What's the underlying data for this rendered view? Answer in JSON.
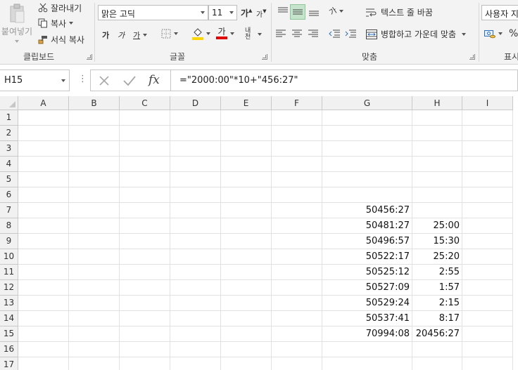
{
  "ribbon": {
    "clipboard": {
      "paste_label": "붙여넣기",
      "cut_label": "잘라내기",
      "copy_label": "복사",
      "format_painter_label": "서식 복사",
      "group_label": "클립보드"
    },
    "font": {
      "font_name": "맑은 고딕",
      "font_size": "11",
      "grow_label": "가",
      "shrink_label": "가",
      "bold_label": "가",
      "italic_label": "가",
      "underline_label": "가",
      "font_color_label": "가",
      "phonetic_label": "내천",
      "group_label": "글꼴",
      "fill_color": "#ffd700",
      "font_color": "#e00000"
    },
    "alignment": {
      "wrap_text_label": "텍스트 줄 바꿈",
      "merge_center_label": "병합하고 가운데 맞춤",
      "orientation_label": "가",
      "group_label": "맞춤"
    },
    "number": {
      "format_value": "사용자 지",
      "percent_label": "%",
      "group_label": "표시"
    }
  },
  "formula_bar": {
    "name_box": "H15",
    "formula": "=\"2000:00\"*10+\"456:27\"",
    "fx_label": "fx"
  },
  "sheet": {
    "columns": [
      "A",
      "B",
      "C",
      "D",
      "E",
      "F",
      "G",
      "H",
      "I"
    ],
    "rows": [
      "1",
      "2",
      "3",
      "4",
      "5",
      "6",
      "7",
      "8",
      "9",
      "10",
      "11",
      "12",
      "13",
      "14",
      "15",
      "16",
      "17"
    ],
    "g_values": [
      "",
      "",
      "",
      "",
      "",
      "",
      "50456:27",
      "50481:27",
      "50496:57",
      "50522:17",
      "50525:12",
      "50527:09",
      "50529:24",
      "50537:41",
      "70994:08",
      "",
      ""
    ],
    "h_values": [
      "",
      "",
      "",
      "",
      "",
      "",
      "",
      "25:00",
      "15:30",
      "25:20",
      "2:55",
      "1:57",
      "2:15",
      "8:17",
      "20456:27",
      "",
      ""
    ]
  }
}
